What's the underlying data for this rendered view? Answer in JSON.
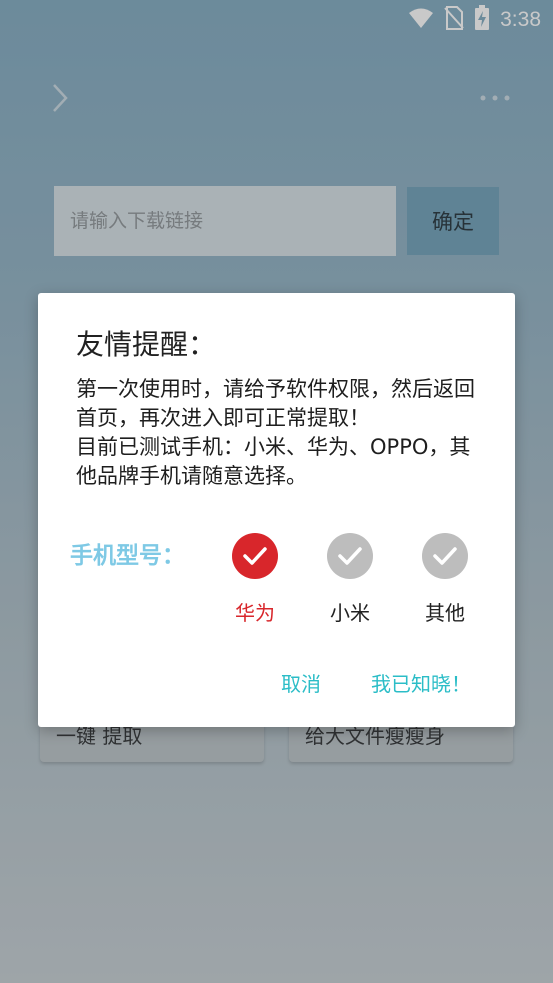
{
  "status_bar": {
    "time": "3:38",
    "icons": [
      "wifi-icon",
      "no-sim-icon",
      "battery-charging-icon"
    ]
  },
  "toolbar": {
    "back_icon": "chevron-right-icon",
    "menu_icon": "more-horizontal-icon"
  },
  "download": {
    "placeholder": "请输入下载链接",
    "confirm_label": "确定"
  },
  "cards": {
    "left_label": "一键 提取",
    "right_label": "给大文件瘦瘦身"
  },
  "dialog": {
    "title": "友情提醒：",
    "message": "第一次使用时，请给予软件权限，然后返回首页，再次进入即可正常提取！\n目前已测试手机：小米、华为、OPPO，其他品牌手机请随意选择。",
    "model_label": "手机型号：",
    "options": [
      {
        "label": "华为",
        "selected": true
      },
      {
        "label": "小米",
        "selected": false
      },
      {
        "label": "其他",
        "selected": false
      }
    ],
    "cancel_label": "取消",
    "ack_label": "我已知晓！"
  },
  "colors": {
    "accent_teal": "#2bbdc7",
    "selected_red": "#d8262b",
    "unselected_gray": "#bdbdbd",
    "label_blue": "#7ec9e5"
  }
}
